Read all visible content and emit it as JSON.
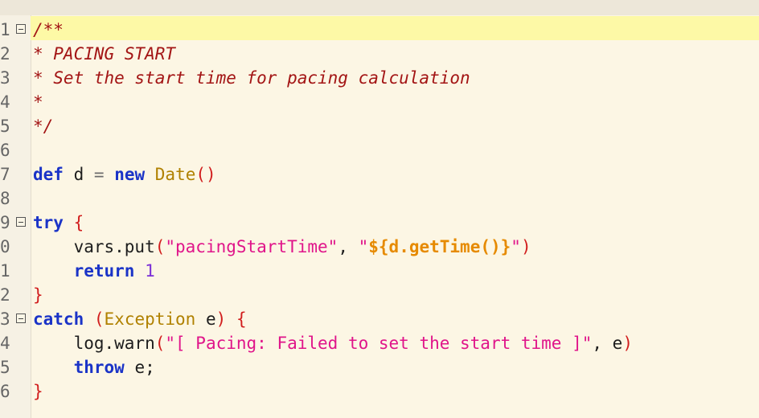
{
  "editor": {
    "line_numbers": [
      "1",
      "2",
      "3",
      "4",
      "5",
      "6",
      "7",
      "8",
      "9",
      "0",
      "1",
      "2",
      "3",
      "4",
      "5",
      "6"
    ],
    "lines": [
      [
        {
          "t": "/**",
          "c": "cm"
        }
      ],
      [
        {
          "t": "* PACING START",
          "c": "cm"
        }
      ],
      [
        {
          "t": "* Set the start time for pacing calculation",
          "c": "cm"
        }
      ],
      [
        {
          "t": "*",
          "c": "cm"
        }
      ],
      [
        {
          "t": "*/",
          "c": "cm"
        }
      ],
      [],
      [
        {
          "t": "def",
          "c": "kw"
        },
        {
          "t": " d ",
          "c": "pl"
        },
        {
          "t": "=",
          "c": "op"
        },
        {
          "t": " ",
          "c": "pl"
        },
        {
          "t": "new",
          "c": "kw"
        },
        {
          "t": " ",
          "c": "pl"
        },
        {
          "t": "Date",
          "c": "ty"
        },
        {
          "t": "()",
          "c": "br"
        }
      ],
      [],
      [
        {
          "t": "try",
          "c": "kw"
        },
        {
          "t": " ",
          "c": "pl"
        },
        {
          "t": "{",
          "c": "br"
        }
      ],
      [
        {
          "t": "    vars.put",
          "c": "pl"
        },
        {
          "t": "(",
          "c": "br"
        },
        {
          "t": "\"pacingStartTime\"",
          "c": "str"
        },
        {
          "t": ", ",
          "c": "pl"
        },
        {
          "t": "\"",
          "c": "str"
        },
        {
          "t": "${d.getTime()}",
          "c": "interp"
        },
        {
          "t": "\"",
          "c": "str"
        },
        {
          "t": ")",
          "c": "br"
        }
      ],
      [
        {
          "t": "    ",
          "c": "pl"
        },
        {
          "t": "return",
          "c": "kw"
        },
        {
          "t": " ",
          "c": "pl"
        },
        {
          "t": "1",
          "c": "num"
        }
      ],
      [
        {
          "t": "}",
          "c": "br"
        }
      ],
      [
        {
          "t": "catch",
          "c": "kw"
        },
        {
          "t": " ",
          "c": "pl"
        },
        {
          "t": "(",
          "c": "br"
        },
        {
          "t": "Exception",
          "c": "ty"
        },
        {
          "t": " e",
          "c": "pl"
        },
        {
          "t": ")",
          "c": "br"
        },
        {
          "t": " ",
          "c": "pl"
        },
        {
          "t": "{",
          "c": "br"
        }
      ],
      [
        {
          "t": "    log.warn",
          "c": "pl"
        },
        {
          "t": "(",
          "c": "br"
        },
        {
          "t": "\"[ Pacing: Failed to set the start time ]\"",
          "c": "str"
        },
        {
          "t": ", e",
          "c": "pl"
        },
        {
          "t": ")",
          "c": "br"
        }
      ],
      [
        {
          "t": "    ",
          "c": "pl"
        },
        {
          "t": "throw",
          "c": "kw"
        },
        {
          "t": " e;",
          "c": "pl"
        }
      ],
      [
        {
          "t": "}",
          "c": "br"
        }
      ]
    ],
    "fold_markers": [
      true,
      false,
      false,
      false,
      false,
      false,
      false,
      false,
      true,
      false,
      false,
      false,
      true,
      false,
      false,
      false
    ]
  }
}
